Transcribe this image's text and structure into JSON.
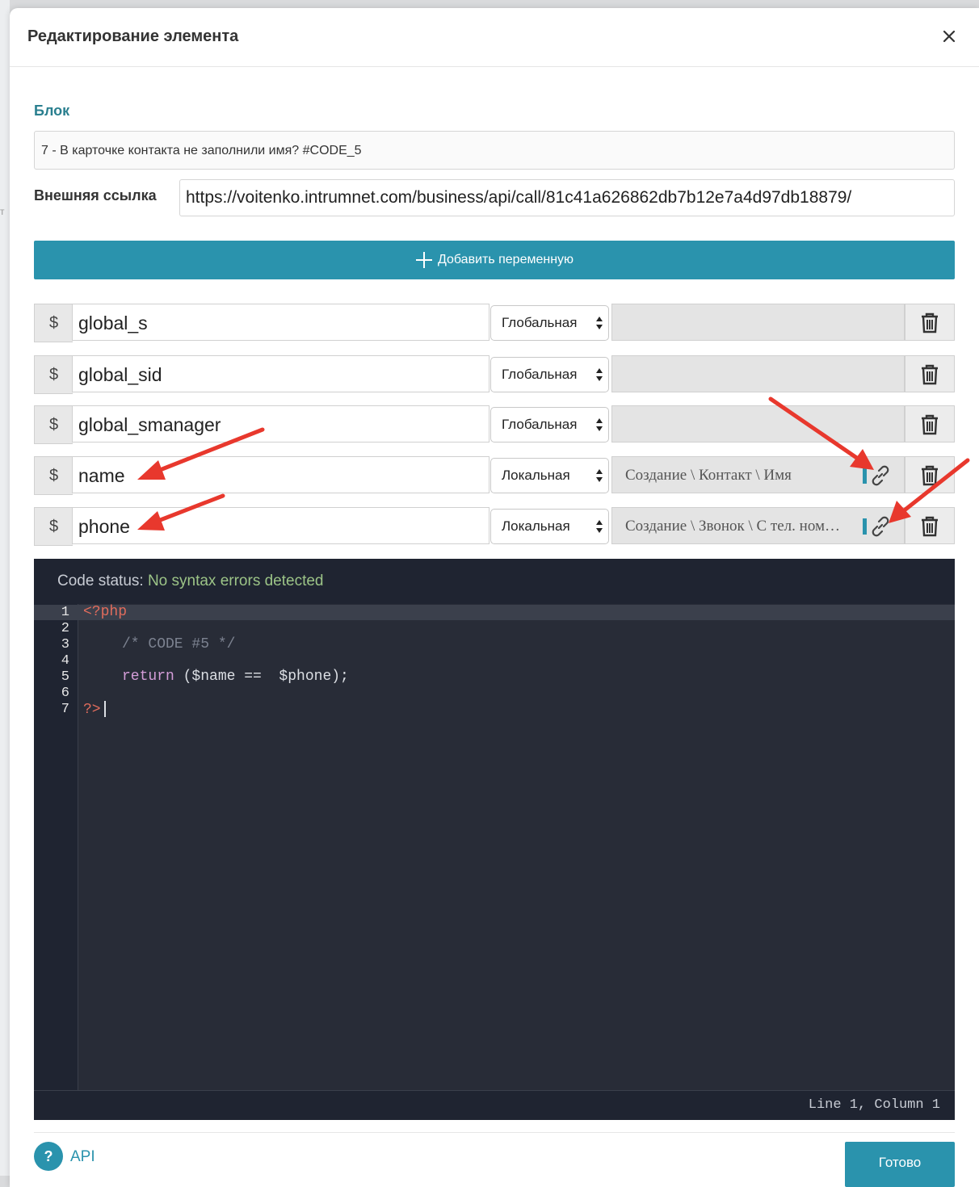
{
  "modal": {
    "title": "Редактирование элемента"
  },
  "block": {
    "label": "Блок",
    "value": "7 - В карточке контакта не заполнили имя? #CODE_5"
  },
  "external_link": {
    "label": "Внешняя ссылка",
    "value": "https://voitenko.intrumnet.com/business/api/call/81c41a626862db7b12e7a4d97db18879/"
  },
  "add_variable_label": "Добавить переменную",
  "variables": [
    {
      "prefix": "$",
      "name": "global_s",
      "scope": "Глобальная",
      "value": ""
    },
    {
      "prefix": "$",
      "name": "global_sid",
      "scope": "Глобальная",
      "value": ""
    },
    {
      "prefix": "$",
      "name": "global_smanager",
      "scope": "Глобальная",
      "value": ""
    },
    {
      "prefix": "$",
      "name": "name",
      "scope": "Локальная",
      "value": "Создание \\ Контакт \\ Имя"
    },
    {
      "prefix": "$",
      "name": "phone",
      "scope": "Локальная",
      "value": "Создание \\ Звонок \\ С тел. ном…"
    }
  ],
  "editor": {
    "status_label": "Code status:",
    "status_value": "No syntax errors detected",
    "line_numbers": [
      "1",
      "2",
      "3",
      "4",
      "5",
      "6",
      "7"
    ],
    "lines": {
      "l1": "<?php",
      "l3": "/* CODE #5 */",
      "l5_kw": "return",
      "l5_rest": " ($name ==  $phone);",
      "l7": "?>"
    },
    "cursor_position": "Line 1, Column 1"
  },
  "footer": {
    "help_label": "?",
    "api_label": "API",
    "done_label": "Готово"
  },
  "colors": {
    "accent": "#2a93ad",
    "section_label": "#2a7f8f",
    "editor_bg": "#282c37",
    "status_ok": "#9cc487",
    "annotation_arrow": "#e8382d"
  }
}
